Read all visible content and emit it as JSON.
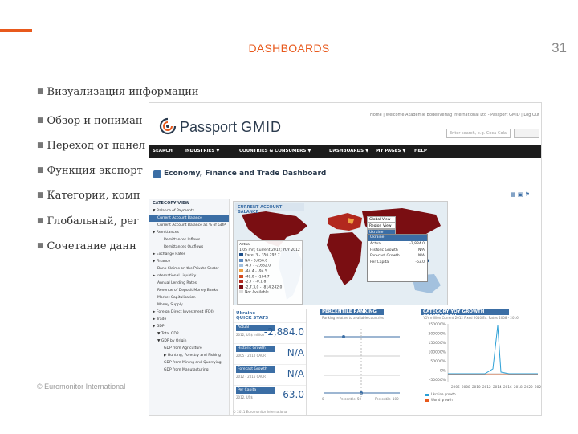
{
  "slide": {
    "title": "DASHBOARDS",
    "number": "31",
    "footer": "© Euromonitor International",
    "accent_color": "#e8591c",
    "bullets": [
      "Визуализация информации",
      "Обзор и пониман",
      "Переход от панел",
      "Функция экспорт",
      "Категории, комп",
      "Глобальный, рег",
      "Сочетание данн"
    ]
  },
  "screenshot": {
    "logo_name": "Passport",
    "logo_suffix": "GMID",
    "top_links": "Home | Welcome Akademie Bodenverlag International Ltd - Passport GMID | Log Out",
    "search_placeholder": "Enter search, e.g. Coca-Cola",
    "nav": [
      "SEARCH",
      "INDUSTRIES ▼",
      "COUNTRIES & CONSUMERS ▼",
      "DASHBOARDS ▼",
      "MY PAGES ▼",
      "HELP"
    ],
    "dashboard_title": "Economy, Finance and Trade Dashboard",
    "sidebar_header": "CATEGORY VIEW",
    "sidebar_items": [
      {
        "label": "▼ Balance of Payments",
        "level": 0,
        "active": false
      },
      {
        "label": "Current Account Balance",
        "level": 1,
        "active": true
      },
      {
        "label": "Current Account Balance as % of GDP",
        "level": 1,
        "active": false
      },
      {
        "label": "▼ Remittances",
        "level": 0,
        "active": false
      },
      {
        "label": "Remittances Inflows",
        "level": 2,
        "active": false
      },
      {
        "label": "Remittances Outflows",
        "level": 2,
        "active": false
      },
      {
        "label": "▶ Exchange Rates",
        "level": 0,
        "active": false
      },
      {
        "label": "▼ Finance",
        "level": 0,
        "active": false
      },
      {
        "label": "Bank Claims on the Private Sector",
        "level": 1,
        "active": false
      },
      {
        "label": "▶ International Liquidity",
        "level": 0,
        "active": false
      },
      {
        "label": "Annual Lending Rates",
        "level": 1,
        "active": false
      },
      {
        "label": "Revenue of Deposit Money Banks",
        "level": 1,
        "active": false
      },
      {
        "label": "Market Capitalisation",
        "level": 1,
        "active": false
      },
      {
        "label": "Money Supply",
        "level": 1,
        "active": false
      },
      {
        "label": "▶ Foreign Direct Investment (FDI)",
        "level": 0,
        "active": false
      },
      {
        "label": "▶ Trade",
        "level": 0,
        "active": false
      },
      {
        "label": "▼ GDP",
        "level": 0,
        "active": false
      },
      {
        "label": "▼ Total GDP",
        "level": 1,
        "active": false
      },
      {
        "label": "▼ GDP by Origin",
        "level": 1,
        "active": false
      },
      {
        "label": "GDP from Agriculture",
        "level": 2,
        "active": false
      },
      {
        "label": "▶ Hunting, Forestry and Fishing",
        "level": 2,
        "active": false
      },
      {
        "label": "GDP from Mining and Quarrying",
        "level": 2,
        "active": false
      },
      {
        "label": "GDP from Manufacturing",
        "level": 2,
        "active": false
      }
    ],
    "map_tab": "CURRENT ACCOUNT BALANCE",
    "map_menu": [
      "Global View",
      "Region View",
      "Ukraine"
    ],
    "map_legend_header": "Actual",
    "map_legend_note": "1.05 mn; Current 2012; YOY 2012 Ex. rates 2010",
    "legend": [
      {
        "label": "Excel 3 - 356,292.7",
        "color": "#1d4f8a"
      },
      {
        "label": "NA - 0,856.0",
        "color": "#5d8cc3"
      },
      {
        "label": "-4.7 - -2,632.0",
        "color": "#a3c1de"
      },
      {
        "label": "-44.4 - -94.5",
        "color": "#f0a040"
      },
      {
        "label": "-48.0 - -164.7",
        "color": "#d24a1f"
      },
      {
        "label": "-2.7 - -0.1,8",
        "color": "#b2281e"
      },
      {
        "label": "-2,7.3,0 - -814,242.0",
        "color": "#7a0e12"
      },
      {
        "label": "Not Available",
        "color": "#dcdcdc"
      }
    ],
    "popup_title": "Ukraine",
    "popup_rows": [
      {
        "label": "Actual",
        "value": "-2,884.0"
      },
      {
        "label": "Historic Growth",
        "value": "N/A"
      },
      {
        "label": "Forecast Growth",
        "value": "N/A"
      },
      {
        "label": "Per Capita",
        "value": "-63.0"
      }
    ],
    "quick_country": "Ukraine",
    "quick_title": "QUICK STATS",
    "quick_stats": [
      {
        "label": "Actual",
        "sub": "2012, US$ million",
        "value": "-2,884.0"
      },
      {
        "label": "Historic Growth",
        "sub": "2005 - 2010 CAGR",
        "value": "N/A"
      },
      {
        "label": "Forecast Growth",
        "sub": "2012 - 2016 CAGR",
        "value": "N/A"
      },
      {
        "label": "Per Capita",
        "sub": "2012, US$",
        "value": "-63.0"
      }
    ],
    "percentile_title": "PERCENTILE RANKING",
    "percentile_sub": "Ranking relative to available countries",
    "percentile_marks": [
      "0",
      "Percentile",
      "50",
      "Percentile",
      "100"
    ],
    "category_title": "CATEGORY YOY GROWTH COMPARISON",
    "category_sub": "YOY million Current 2012 Fixed 2010 Ex. Rates 2008 - 2016",
    "category_yticks": [
      "250000%",
      "200000%",
      "150000%",
      "100000%",
      "50000%",
      "0%",
      "-50000%"
    ],
    "category_xticks": [
      "2006",
      "2008",
      "2010",
      "2012",
      "2014",
      "2016",
      "2018",
      "2020",
      "2022"
    ],
    "category_legend": [
      "Ukraine growth",
      "World growth"
    ],
    "copyright": "© 2011 Euromonitor International"
  }
}
